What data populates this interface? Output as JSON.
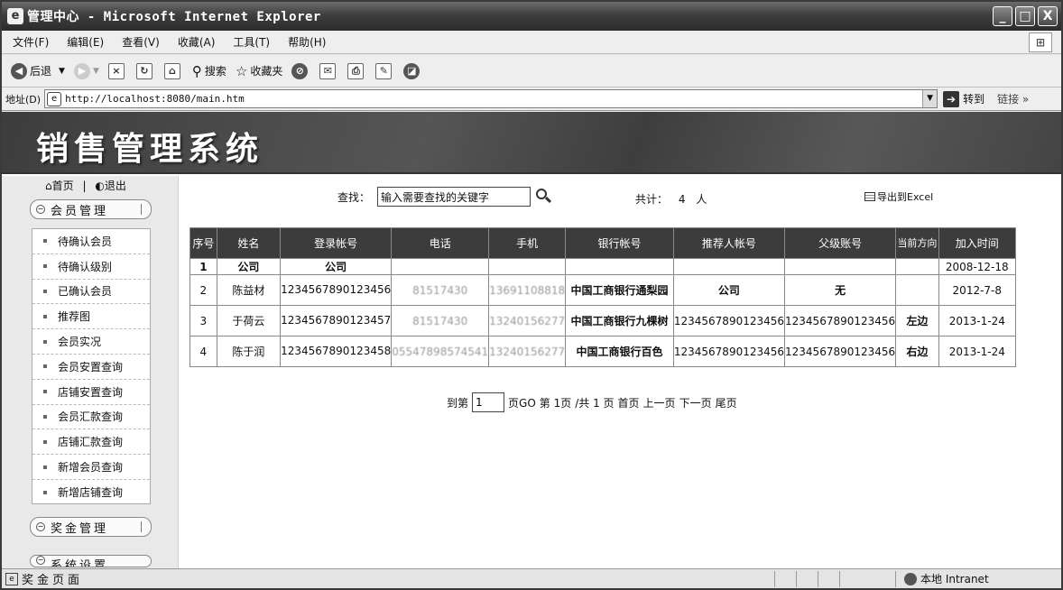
{
  "window": {
    "title": "管理中心 - Microsoft Internet Explorer",
    "buttons": {
      "min": "_",
      "max": "□",
      "close": "X"
    }
  },
  "menubar": {
    "items": [
      "文件(F)",
      "编辑(E)",
      "查看(V)",
      "收藏(A)",
      "工具(T)",
      "帮助(H)"
    ]
  },
  "toolbar": {
    "back": "后退",
    "search": "搜索",
    "favorites": "收藏夹"
  },
  "addressbar": {
    "label": "地址(D)",
    "url": "http://localhost:8080/main.htm",
    "go": "转到",
    "links": "链接 »"
  },
  "banner": {
    "title": "销售管理系统"
  },
  "sidebar": {
    "home": "首页",
    "separator": "|",
    "logout": "退出",
    "groups": [
      {
        "label": "会员管理"
      },
      {
        "label": "奖金管理"
      },
      {
        "label": "系统设置"
      }
    ],
    "items": [
      "待确认会员",
      "待确认级别",
      "已确认会员",
      "推荐图",
      "会员实况",
      "会员安置查询",
      "店铺安置查询",
      "会员汇款查询",
      "店铺汇款查询",
      "新增会员查询",
      "新增店铺查询"
    ]
  },
  "search": {
    "label": "查找：",
    "value": "输入需要查找的关键字"
  },
  "total": {
    "label": "共计：",
    "count": "4",
    "unit": "人"
  },
  "export": {
    "label": "导出到Excel"
  },
  "table": {
    "headers": [
      "序号",
      "姓名",
      "登录帐号",
      "电话",
      "手机",
      "银行帐号",
      "推荐人帐号",
      "父级账号",
      "当前方向",
      "加入时间"
    ],
    "rows": [
      [
        "1",
        "公司",
        "公司",
        "",
        "",
        "",
        "",
        "",
        "",
        "2008-12-18"
      ],
      [
        "2",
        "陈益材",
        "1234567890123456",
        "81517430",
        "13691108818",
        "中国工商银行通梨园",
        "公司",
        "无",
        "",
        "2012-7-8"
      ],
      [
        "3",
        "于荷云",
        "1234567890123457",
        "81517430",
        "13240156277",
        "中国工商银行九棵树",
        "1234567890123456",
        "1234567890123456",
        "左边",
        "2013-1-24"
      ],
      [
        "4",
        "陈于润",
        "1234567890123458",
        "05547898574541",
        "13240156277",
        "中国工商银行百色",
        "1234567890123456",
        "1234567890123456",
        "右边",
        "2013-1-24"
      ]
    ]
  },
  "pager": {
    "to": "到第",
    "page_value": "1",
    "go": "页GO",
    "current": "第 1页",
    "total": "/共 1 页",
    "first": "首页",
    "prev": "上一页",
    "next": "下一页",
    "last": "尾页"
  },
  "statusbar": {
    "text": "奖金页面",
    "zone": "本地 Intranet"
  }
}
